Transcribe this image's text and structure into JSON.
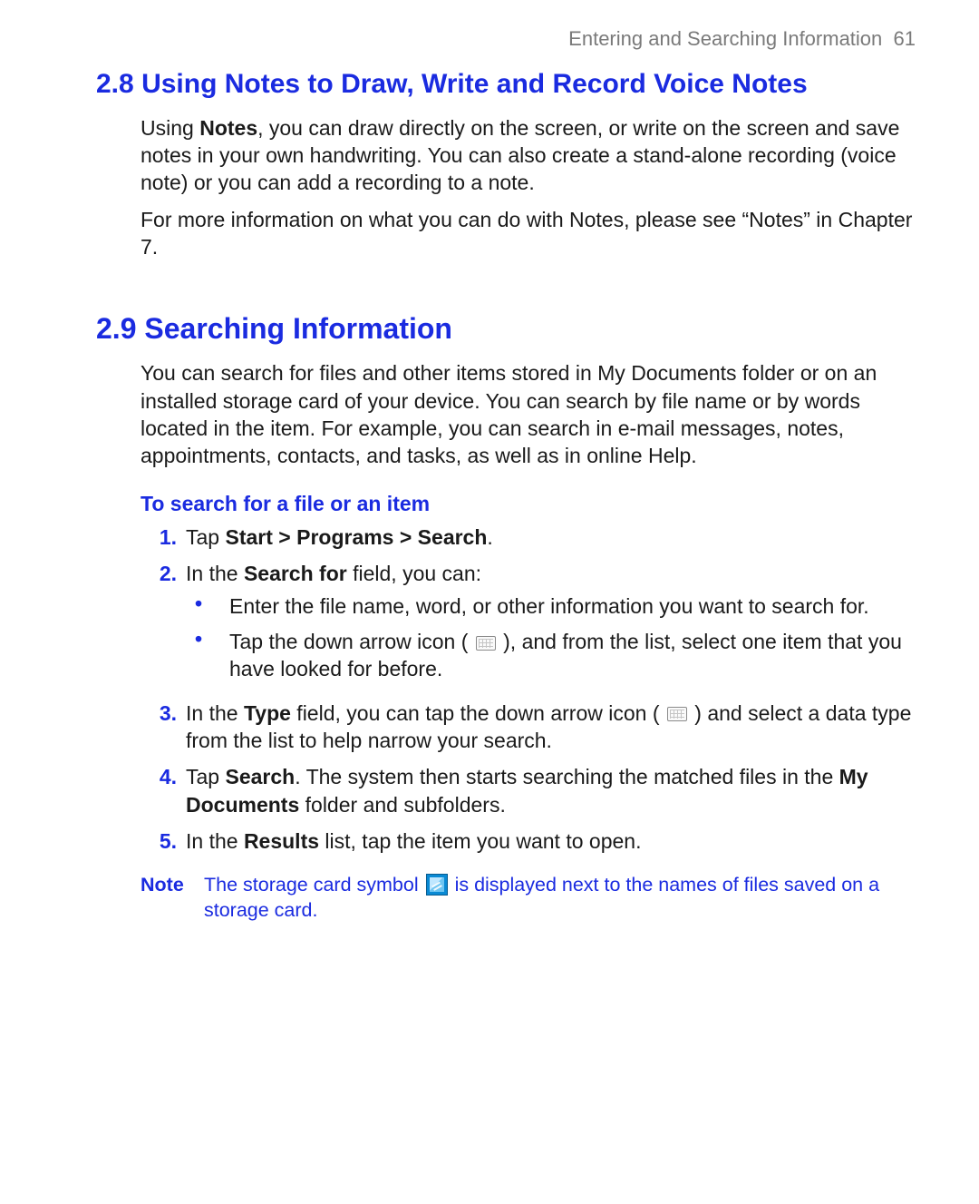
{
  "header": {
    "running": "Entering and Searching Information",
    "page_number": "61"
  },
  "section28": {
    "number": "2.8",
    "title": "Using Notes to Draw, Write and Record Voice Notes",
    "para1_a": "Using ",
    "para1_bold": "Notes",
    "para1_b": ", you can draw directly on the screen, or write on the screen and save notes in your own handwriting. You can also create a stand-alone recording (voice note) or you can add a recording to a note.",
    "para2": "For more information on what you can do with Notes, please see “Notes” in Chapter 7."
  },
  "section29": {
    "number": "2.9",
    "title": "Searching Information",
    "para1": "You can search for files and other items stored in My Documents folder or on an installed storage card of your device. You can search by file name or by words located in the item. For example, you can search in e-mail messages, notes, appointments, contacts, and tasks, as well as in online Help.",
    "subhead": "To search for a file or an item",
    "steps": {
      "s1": {
        "num": "1.",
        "a": "Tap ",
        "b_bold": "Start > Programs > Search",
        "c": "."
      },
      "s2": {
        "num": "2.",
        "a": "In the ",
        "b_bold": "Search for",
        "c": " field, you can:",
        "bul1": "Enter the file name, word, or other information you want to search for.",
        "bul2_a": "Tap the down arrow icon (",
        "bul2_b": "), and from the list, select one item that you have looked for before."
      },
      "s3": {
        "num": "3.",
        "a": "In the ",
        "b_bold": "Type",
        "c": " field, you can tap the down arrow icon (",
        "d": ") and select a data type from the list to help narrow your search."
      },
      "s4": {
        "num": "4.",
        "a": "Tap ",
        "b_bold": "Search",
        "c": ". The system then starts searching the matched files in the ",
        "d_bold": "My Documents",
        "e": " folder and subfolders."
      },
      "s5": {
        "num": "5.",
        "a": "In the ",
        "b_bold": "Results",
        "c": " list, tap the item you want to open."
      }
    },
    "note": {
      "label": "Note",
      "a": "The storage card symbol ",
      "b": " is displayed next to the names of files saved on a storage card."
    }
  }
}
